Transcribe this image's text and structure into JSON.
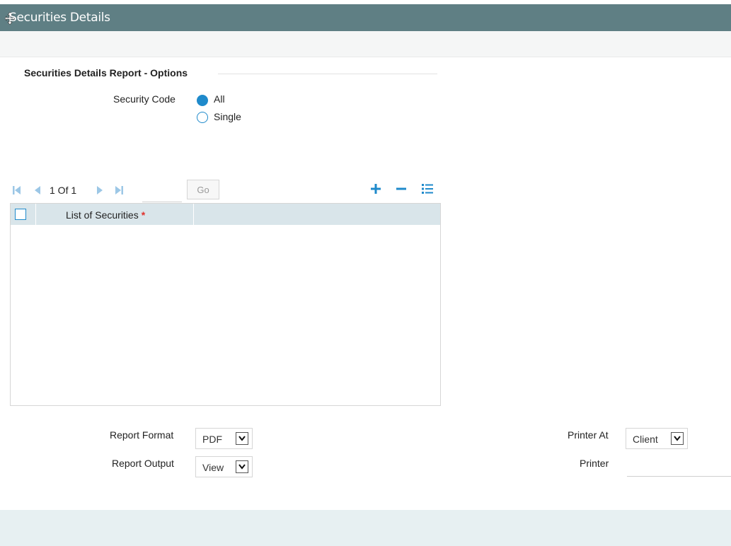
{
  "window": {
    "title": "Securities Details"
  },
  "section": {
    "title": "Securities Details Report - Options"
  },
  "security_code": {
    "label": "Security Code",
    "options": [
      {
        "label": "All",
        "selected": true
      },
      {
        "label": "Single",
        "selected": false
      }
    ]
  },
  "pager": {
    "text": "1 Of 1",
    "go_label": "Go",
    "page_value": ""
  },
  "grid": {
    "columns": [
      {
        "label": "List of Securities",
        "required": true,
        "required_mark": "*"
      }
    ],
    "rows": []
  },
  "report": {
    "format_label": "Report Format",
    "format_value": "PDF",
    "output_label": "Report Output",
    "output_value": "View",
    "printer_at_label": "Printer At",
    "printer_at_value": "Client",
    "printer_label": "Printer",
    "printer_value": ""
  },
  "colors": {
    "title_bar": "#5f7f84",
    "accent": "#1f8acb",
    "grid_header": "#d9e5ea",
    "footer": "#e7f0f2",
    "required": "#e0312c"
  },
  "icons": [
    "move-icon",
    "first-page-icon",
    "previous-page-icon",
    "next-page-icon",
    "last-page-icon",
    "add-row-icon",
    "delete-row-icon",
    "view-list-icon",
    "dropdown-arrow-icon"
  ]
}
